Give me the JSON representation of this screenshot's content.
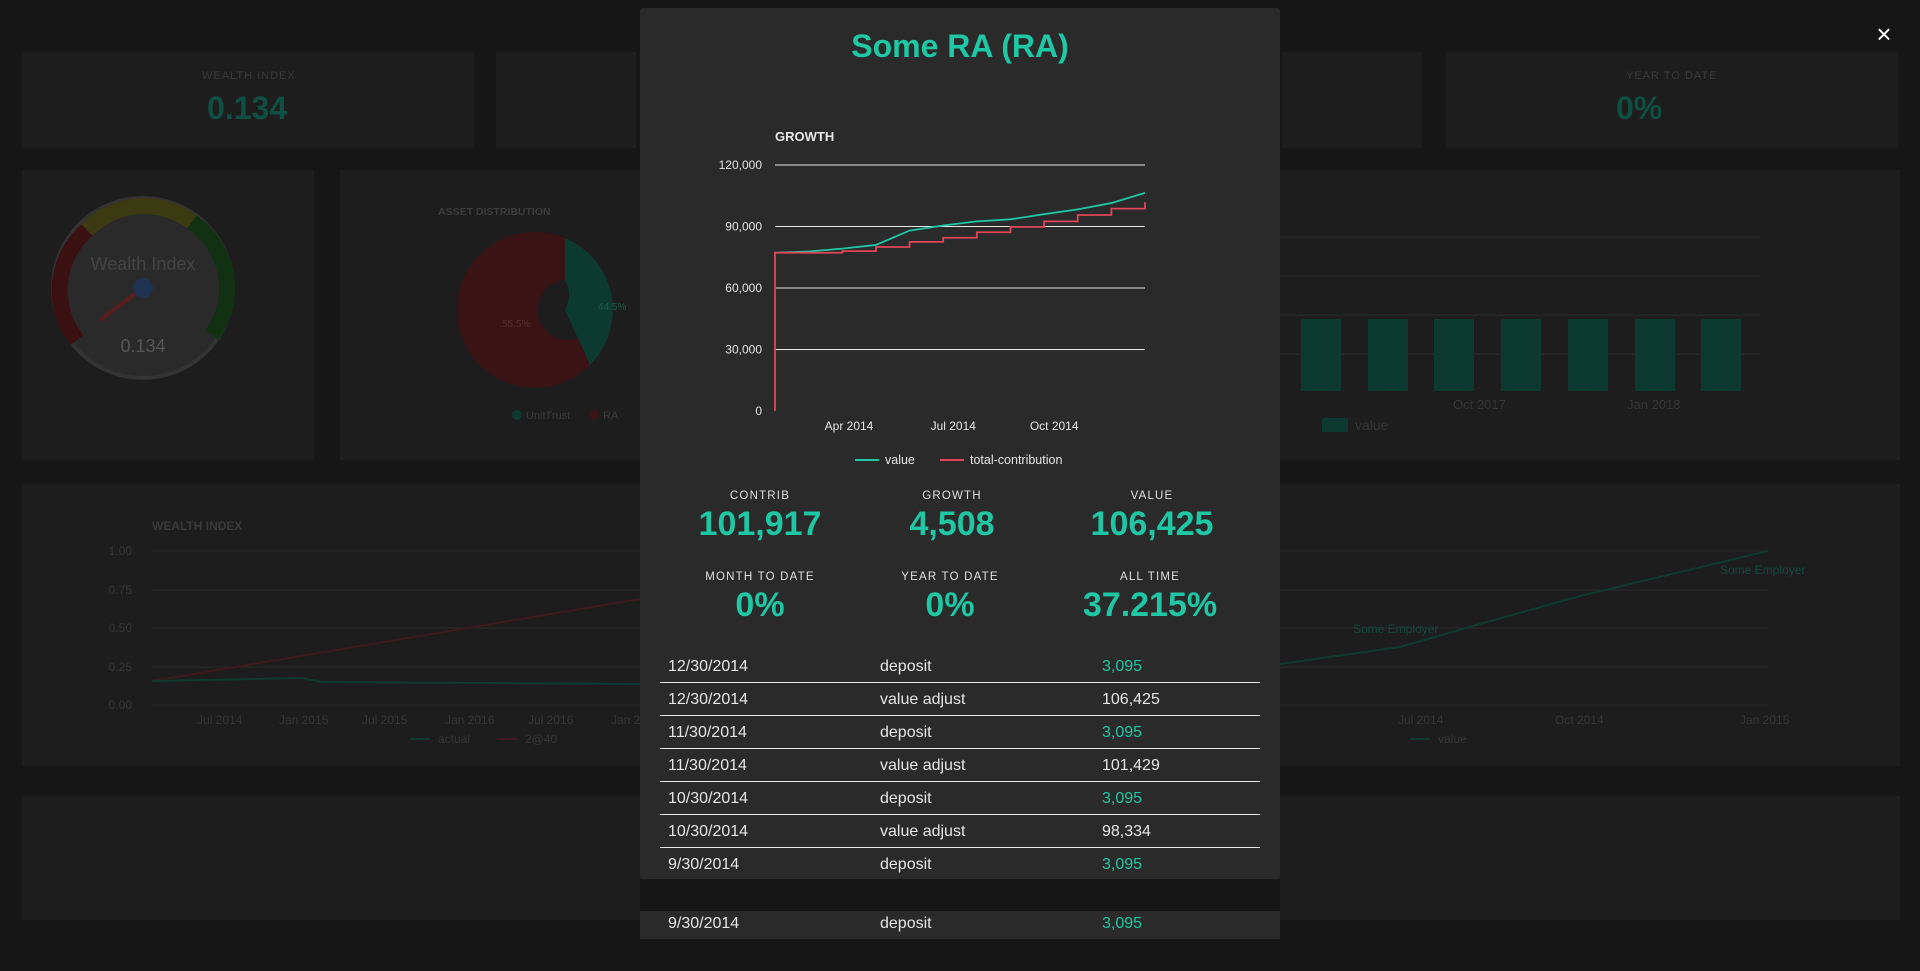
{
  "background": {
    "top_cards": [
      {
        "label": "WEALTH INDEX",
        "value": "0.134"
      },
      {
        "label": "YEAR TO DATE",
        "value": "0%"
      }
    ],
    "gauge": {
      "label": "Wealth Index",
      "value": "0.134",
      "ticks": [
        "1",
        "2",
        "3",
        "4",
        "5"
      ]
    },
    "asset_distribution": {
      "title": "ASSET DISTRIBUTION",
      "slices": [
        "55.5%",
        "44.5%"
      ],
      "legend": [
        "UnitTrust",
        "RA"
      ]
    },
    "bar_panel": {
      "xticks": [
        "Oct 2017",
        "Jan 2018"
      ],
      "legend": "value"
    },
    "wealth_index_chart": {
      "title": "WEALTH INDEX",
      "yticks": [
        "1.00",
        "0.75",
        "0.50",
        "0.25",
        "0.00"
      ],
      "xticks": [
        "Jul 2014",
        "Jan 2015",
        "Jul 2015",
        "Jan 2016",
        "Jul 2016",
        "Jan 2"
      ],
      "legend": [
        "actual",
        "2@40"
      ]
    },
    "right_line_chart": {
      "xticks": [
        "Jul 2014",
        "Oct 2014",
        "Jan 2015"
      ],
      "labels": [
        "Some Employer",
        "Some Employer"
      ],
      "legend": "value"
    }
  },
  "close_icon": "×",
  "modal": {
    "title": "Some RA (RA)",
    "chart_title": "GROWTH",
    "chart_data": {
      "type": "line",
      "title": "GROWTH",
      "ylim": [
        0,
        120000
      ],
      "yticks": [
        "120,000",
        "90,000",
        "60,000",
        "30,000",
        "0"
      ],
      "xticks": [
        "Apr 2014",
        "Jul 2014",
        "Oct 2014"
      ],
      "series": [
        {
          "name": "value",
          "color": "#1fc7a5",
          "points": [
            [
              0,
              77200
            ],
            [
              1,
              77800
            ],
            [
              2,
              79200
            ],
            [
              3,
              81000
            ],
            [
              4,
              88000
            ],
            [
              5,
              90500
            ],
            [
              6,
              92500
            ],
            [
              7,
              93500
            ],
            [
              8,
              96000
            ],
            [
              9,
              98334
            ],
            [
              10,
              101429
            ],
            [
              11,
              106425
            ]
          ]
        },
        {
          "name": "total-contribution",
          "color": "#e0455a",
          "points": [
            [
              0,
              0
            ],
            [
              0,
              77200
            ],
            [
              1,
              77200
            ],
            [
              2,
              78000
            ],
            [
              3,
              80000
            ],
            [
              4,
              82500
            ],
            [
              5,
              84500
            ],
            [
              6,
              87200
            ],
            [
              7,
              89800
            ],
            [
              8,
              92500
            ],
            [
              9,
              95626
            ],
            [
              10,
              98721
            ],
            [
              11,
              101917
            ]
          ]
        }
      ],
      "legend": [
        "value",
        "total-contribution"
      ]
    },
    "stats_row1": [
      {
        "label": "CONTRIB",
        "value": "101,917"
      },
      {
        "label": "GROWTH",
        "value": "4,508"
      },
      {
        "label": "VALUE",
        "value": "106,425"
      }
    ],
    "stats_row2": [
      {
        "label": "MONTH TO DATE",
        "value": "0%"
      },
      {
        "label": "YEAR TO DATE",
        "value": "0%"
      },
      {
        "label": "ALL TIME",
        "value": "37.215%"
      }
    ],
    "transactions": [
      {
        "date": "12/30/2014",
        "type": "deposit",
        "amount": "3,095",
        "kind": "pos"
      },
      {
        "date": "12/30/2014",
        "type": "value adjust",
        "amount": "106,425",
        "kind": "neu"
      },
      {
        "date": "11/30/2014",
        "type": "deposit",
        "amount": "3,095",
        "kind": "pos"
      },
      {
        "date": "11/30/2014",
        "type": "value adjust",
        "amount": "101,429",
        "kind": "neu"
      },
      {
        "date": "10/30/2014",
        "type": "deposit",
        "amount": "3,095",
        "kind": "pos"
      },
      {
        "date": "10/30/2014",
        "type": "value adjust",
        "amount": "98,334",
        "kind": "neu"
      },
      {
        "date": "9/30/2014",
        "type": "deposit",
        "amount": "3,095",
        "kind": "pos"
      }
    ],
    "last_row": {
      "date": "9/30/2014",
      "type": "deposit",
      "amount": "3,095"
    }
  }
}
